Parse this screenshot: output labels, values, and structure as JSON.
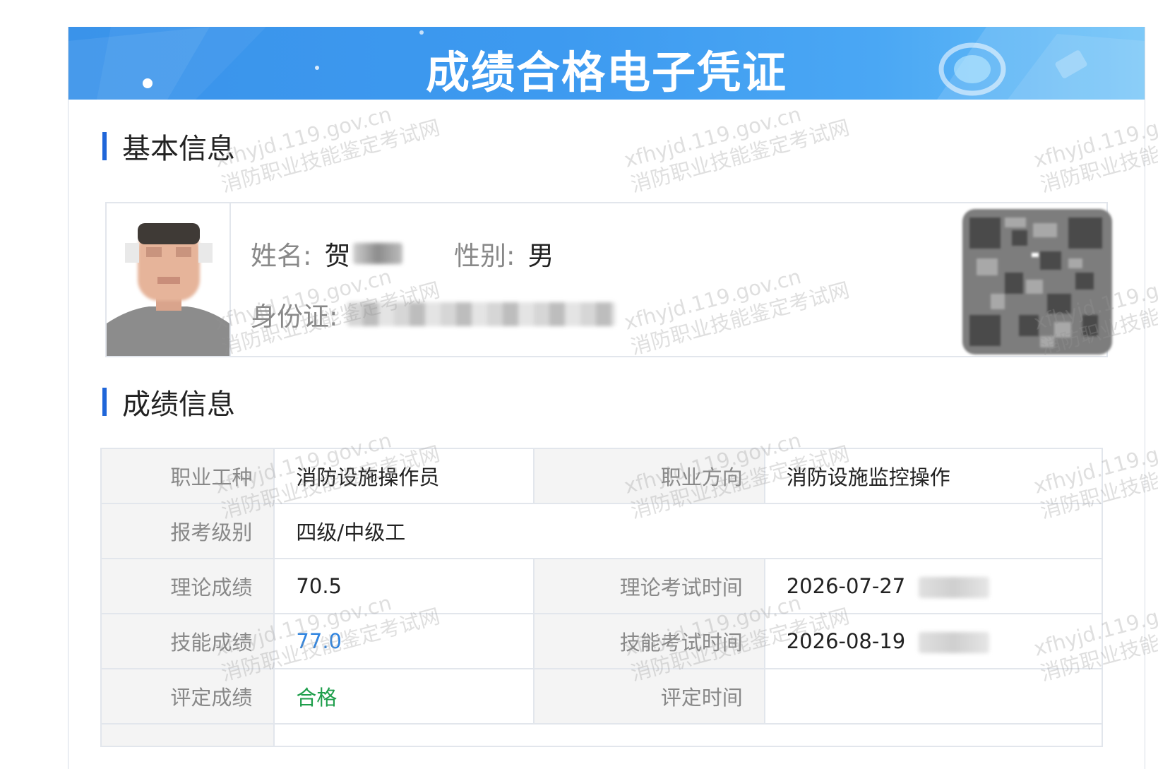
{
  "header": {
    "title": "成绩合格电子凭证"
  },
  "basic_info": {
    "section_title": "基本信息",
    "name_label": "姓名:",
    "name_value": "贺",
    "gender_label": "性别:",
    "gender_value": "男",
    "id_label": "身份证:"
  },
  "score_info": {
    "section_title": "成绩信息",
    "rows": [
      {
        "label1": "职业工种",
        "value1": "消防设施操作员",
        "label2": "职业方向",
        "value2": "消防设施监控操作"
      },
      {
        "label1": "报考级别",
        "value1": "四级/中级工"
      },
      {
        "label1": "理论成绩",
        "value1": "70.5",
        "label2": "理论考试时间",
        "value2": "2026-07-27"
      },
      {
        "label1": "技能成绩",
        "value1": "77.0",
        "label2": "技能考试时间",
        "value2": "2026-08-19"
      },
      {
        "label1": "评定成绩",
        "value1": "合格",
        "label2": "评定时间",
        "value2": ""
      }
    ]
  },
  "watermark": {
    "line1": "xfhyjd.119.gov.cn",
    "line2": "消防职业技能鉴定考试网"
  },
  "colors": {
    "banner": "#3d9af0",
    "section_accent": "#1f66d9",
    "skill_score": "#2f84e0",
    "pass": "#1e9e4b"
  }
}
